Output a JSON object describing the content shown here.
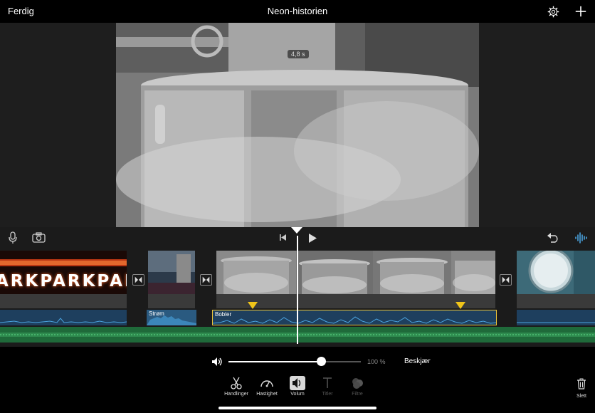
{
  "topbar": {
    "done_label": "Ferdig",
    "title": "Neon-historien",
    "settings_icon": "gear-icon",
    "add_icon": "plus-icon"
  },
  "viewer": {
    "duration_badge": "4,8 s"
  },
  "timeline_controls": {
    "mic_icon": "microphone-icon",
    "camera_icon": "camera-icon",
    "skip_start_icon": "skip-to-start-icon",
    "play_icon": "play-icon",
    "undo_icon": "undo-icon",
    "waveform_icon": "waveform-icon"
  },
  "timeline": {
    "clip1_text": "ARKPARKPARK",
    "audio_labels": {
      "strom": "Strøm",
      "bobler": "Bobler"
    }
  },
  "bottom": {
    "volume_percent": "100 %",
    "volume_level": 0.7,
    "trim_label": "Beskjær",
    "tools": [
      {
        "label": "Handlinger",
        "icon": "scissors-icon",
        "state": "normal"
      },
      {
        "label": "Hastighet",
        "icon": "speedometer-icon",
        "state": "normal"
      },
      {
        "label": "Volum",
        "icon": "speaker-icon",
        "state": "active"
      },
      {
        "label": "Titler",
        "icon": "title-icon",
        "state": "disabled"
      },
      {
        "label": "Filtre",
        "icon": "filters-icon",
        "state": "disabled"
      }
    ],
    "delete_label": "Slett"
  },
  "colors": {
    "accent_audio": "#4aa3df",
    "selected_clip": "#e8c23a",
    "background_music": "#1f6a3a",
    "marker": "#f0c419"
  }
}
